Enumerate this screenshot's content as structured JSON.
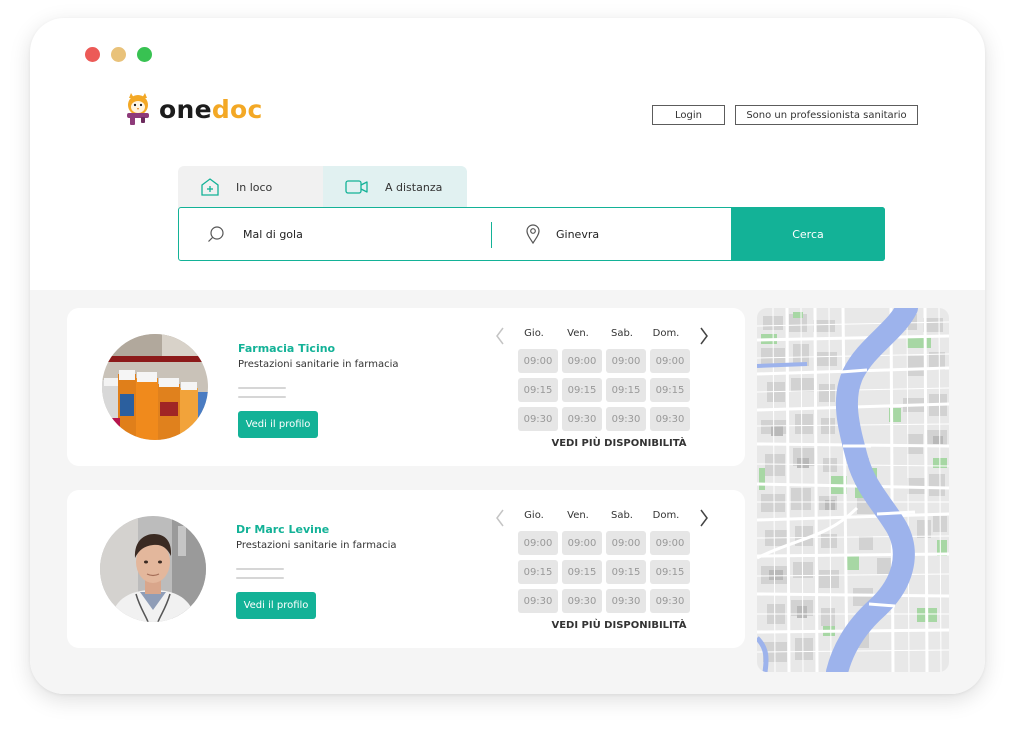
{
  "app": {
    "brand_one": "one",
    "brand_doc": "doc",
    "login_label": "Login",
    "professional_label": "Sono un professionista sanitario"
  },
  "tabs": [
    {
      "label": "In loco",
      "icon": "clinic-icon",
      "active": false
    },
    {
      "label": "A distanza",
      "icon": "video-icon",
      "active": true
    }
  ],
  "search": {
    "what_value": "Mal di gola",
    "where_value": "Ginevra",
    "button_label": "Cerca"
  },
  "schedule_days": [
    "Gio.",
    "Ven.",
    "Sab.",
    "Dom."
  ],
  "results": [
    {
      "name": "Farmacia Ticino",
      "subtitle": "Prestazioni sanitarie in farmacia",
      "profile_label": "Vedi il profilo",
      "slots": [
        [
          "09:00",
          "09:00",
          "09:00",
          "09:00"
        ],
        [
          "09:15",
          "09:15",
          "09:15",
          "09:15"
        ],
        [
          "09:30",
          "09:30",
          "09:30",
          "09:30"
        ]
      ],
      "more_label": "VEDI PIÙ DISPONIBILITÀ"
    },
    {
      "name": "Dr Marc Levine",
      "subtitle": "Prestazioni sanitarie in farmacia",
      "profile_label": "Vedi il profilo",
      "slots": [
        [
          "09:00",
          "09:00",
          "09:00",
          "09:00"
        ],
        [
          "09:15",
          "09:15",
          "09:15",
          "09:15"
        ],
        [
          "09:30",
          "09:30",
          "09:30",
          "09:30"
        ]
      ],
      "more_label": "VEDI PIÙ DISPONIBILITÀ"
    }
  ],
  "colors": {
    "accent": "#13b297",
    "brand_orange": "#f3a825",
    "slot_bg": "#e6e6e6",
    "map_water": "#9db3ec",
    "map_park": "#a7d7a4"
  }
}
